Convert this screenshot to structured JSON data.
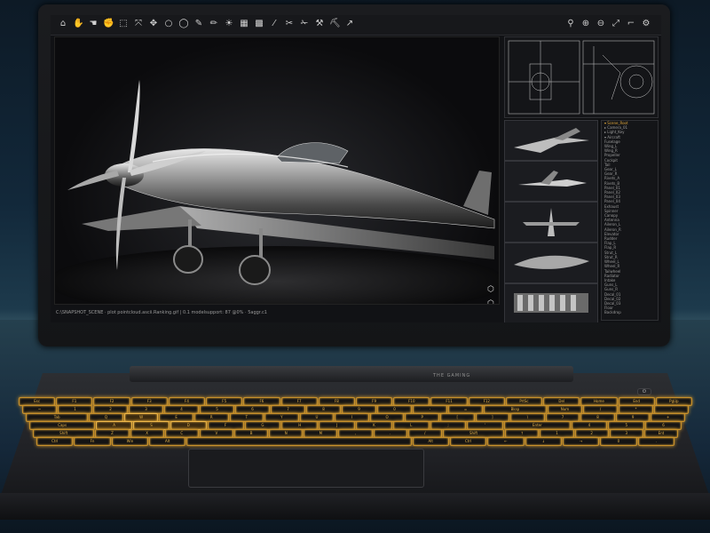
{
  "status_bar": {
    "text": "C:\\SNAPSHOT_SCENE · plot  pointcloud.ascii.Ranking.gif   |   0.1  modelsupport: 87  @0%   ·  5aggr.c1"
  },
  "toolbar_left": [
    "home-tool",
    "hand-tool",
    "pan-tool",
    "grab-tool",
    "select-tool",
    "transform-tool",
    "move-tool",
    "circle-tool",
    "ellipse-tool",
    "pen-tool",
    "paint-tool",
    "bulb-tool",
    "texture-tool",
    "mesh-tool",
    "brush-tool",
    "knife-tool",
    "cut-tool",
    "tools-tool",
    "pick-tool",
    "arrow-tool"
  ],
  "toolbar_right": [
    "search-tool",
    "zoom-in-tool",
    "zoom-out-tool",
    "fit-tool",
    "measure-tool",
    "settings-tool"
  ],
  "tree_items": [
    "▾ Scene_Root",
    "  ▸ Camera_01",
    "  ▸ Light_Key",
    "  ▾ Aircraft",
    "     Fuselage",
    "     Wing_L",
    "     Wing_R",
    "     Propeller",
    "     Cockpit",
    "     Tail",
    "     Gear_L",
    "     Gear_R",
    "     Rivets_A",
    "     Rivets_B",
    "     Panel_01",
    "     Panel_02",
    "     Panel_03",
    "     Panel_04",
    "     Exhaust",
    "     Spinner",
    "     Canopy",
    "     Antenna",
    "     Aileron_L",
    "     Aileron_R",
    "     Elevator",
    "     Rudder",
    "     Flap_L",
    "     Flap_R",
    "     Strut_L",
    "     Strut_R",
    "     Wheel_L",
    "     Wheel_R",
    "     Tailwheel",
    "     Radiator",
    "     Intake",
    "     Guns_L",
    "     Guns_R",
    "     Decal_01",
    "     Decal_02",
    "     Decal_03",
    "     Floor",
    "     Backdrop"
  ],
  "hinge_label": "THE GAMING",
  "keyboard": {
    "row1": [
      "Esc",
      "F1",
      "F2",
      "F3",
      "F4",
      "F5",
      "F6",
      "F7",
      "F8",
      "F9",
      "F10",
      "F11",
      "F12",
      "PrtSc",
      "Del",
      "Home",
      "End",
      "PgUp"
    ],
    "row2": [
      "~",
      "1",
      "2",
      "3",
      "4",
      "5",
      "6",
      "7",
      "8",
      "9",
      "0",
      "-",
      "=",
      "Bksp",
      "Num",
      "/",
      "*",
      "-"
    ],
    "row3": [
      "Tab",
      "Q",
      "W",
      "E",
      "R",
      "T",
      "Y",
      "U",
      "I",
      "O",
      "P",
      "[",
      "]",
      "\\",
      "7",
      "8",
      "9",
      "+"
    ],
    "row4": [
      "Caps",
      "A",
      "S",
      "D",
      "F",
      "G",
      "H",
      "J",
      "K",
      "L",
      ";",
      "'",
      "Enter",
      "4",
      "5",
      "6"
    ],
    "row5": [
      "Shift",
      "Z",
      "X",
      "C",
      "V",
      "B",
      "N",
      "M",
      ",",
      ".",
      "/",
      "Shift",
      "↑",
      "1",
      "2",
      "3",
      "Ent"
    ],
    "row6": [
      "Ctrl",
      "Fn",
      "Win",
      "Alt",
      "",
      "Alt",
      "Ctrl",
      "←",
      "↓",
      "→",
      "0",
      "."
    ]
  },
  "power_symbol": "⏻",
  "colors": {
    "backlight": "#e9b54a",
    "bezel": "#1b1c1f",
    "deck": "#2c2e32"
  }
}
